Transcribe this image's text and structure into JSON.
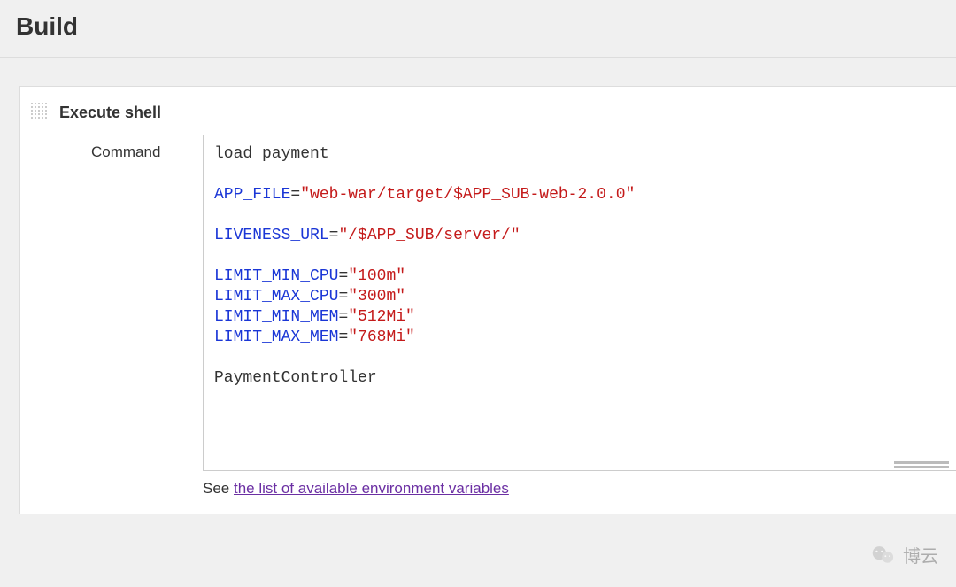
{
  "section": {
    "title": "Build"
  },
  "buildStep": {
    "title": "Execute shell",
    "fieldLabel": "Command",
    "code": {
      "line1": "load payment",
      "line2_var": "APP_FILE",
      "line2_eq": "=",
      "line2_str": "\"web-war/target/$APP_SUB-web-2.0.0\"",
      "line3_var": "LIVENESS_URL",
      "line3_eq": "=",
      "line3_str_open": "\"",
      "line3_str_a": "/$APP_SUB",
      "line3_str_b": "/server/",
      "line3_str_close": "\"",
      "line4_var": "LIMIT_MIN_CPU",
      "line4_eq": "=",
      "line4_str": "\"100m\"",
      "line5_var": "LIMIT_MAX_CPU",
      "line5_eq": "=",
      "line5_str": "\"300m\"",
      "line6_var": "LIMIT_MIN_MEM",
      "line6_eq": "=",
      "line6_str": "\"512Mi\"",
      "line7_var": "LIMIT_MAX_MEM",
      "line7_eq": "=",
      "line7_str": "\"768Mi\"",
      "line8": "PaymentController"
    },
    "hintPrefix": "See ",
    "hintLink": "the list of available environment variables"
  },
  "watermark": {
    "text": "博云"
  }
}
